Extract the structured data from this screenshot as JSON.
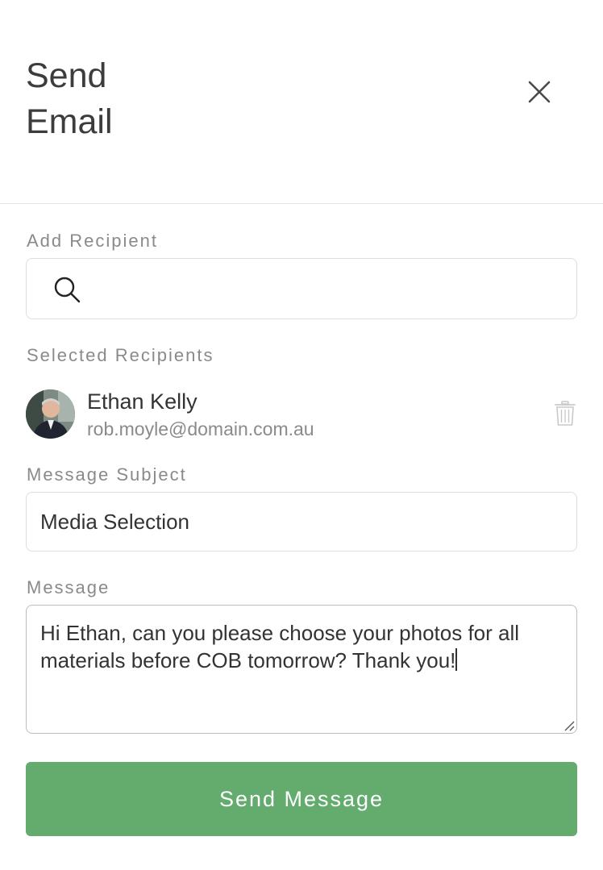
{
  "header": {
    "title": "Send Email"
  },
  "add_recipient": {
    "label": "Add Recipient",
    "placeholder": ""
  },
  "selected_recipients": {
    "label": "Selected Recipients",
    "items": [
      {
        "name": "Ethan Kelly",
        "email": "rob.moyle@domain.com.au"
      }
    ]
  },
  "subject": {
    "label": "Message Subject",
    "value": "Media Selection"
  },
  "message": {
    "label": "Message",
    "value": "Hi Ethan, can you please choose your photos for all materials before COB tomorrow? Thank you!"
  },
  "send_button": {
    "label": "Send Message",
    "color": "#63ac6e"
  }
}
